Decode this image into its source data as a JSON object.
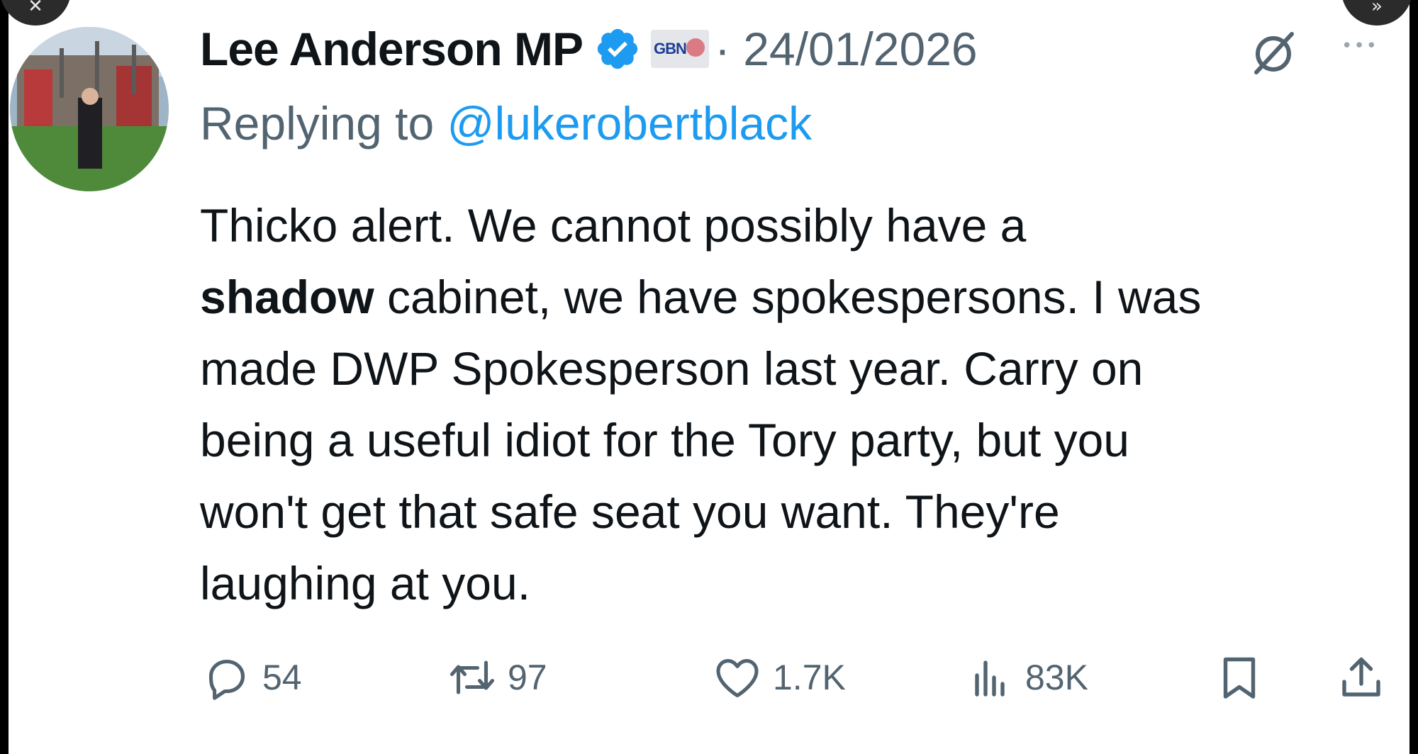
{
  "tweet": {
    "author_name": "Lee Anderson MP",
    "affiliation_badge": "GBN",
    "date": "· 24/01/2026",
    "replying_prefix": "Replying to",
    "replying_handle": "@lukerobertblack",
    "body_lines": [
      {
        "before": "Thicko alert. We cannot possibly have a",
        "bold": "",
        "after": ""
      },
      {
        "before": "",
        "bold": "shadow",
        "after": " cabinet, we have spokespersons. I was"
      },
      {
        "before": "made DWP Spokesperson last year. Carry on",
        "bold": "",
        "after": ""
      },
      {
        "before": "being a useful idiot for the Tory party, but you",
        "bold": "",
        "after": ""
      },
      {
        "before": "won't get that safe seat you want. They're",
        "bold": "",
        "after": ""
      },
      {
        "before": "laughing at you.",
        "bold": "",
        "after": ""
      }
    ]
  },
  "actions": {
    "replies": "54",
    "reposts": "97",
    "likes": "1.7K",
    "views": "83K"
  },
  "icons": {
    "verified": "verified-badge-icon",
    "grok": "grok-icon",
    "reply": "reply-icon",
    "repost": "repost-icon",
    "like": "heart-icon",
    "views": "analytics-icon",
    "bookmark": "bookmark-icon",
    "share": "share-icon"
  },
  "colors": {
    "text": "#0f1419",
    "secondary": "#536471",
    "link": "#1d9bf0",
    "verified": "#1d9bf0"
  }
}
